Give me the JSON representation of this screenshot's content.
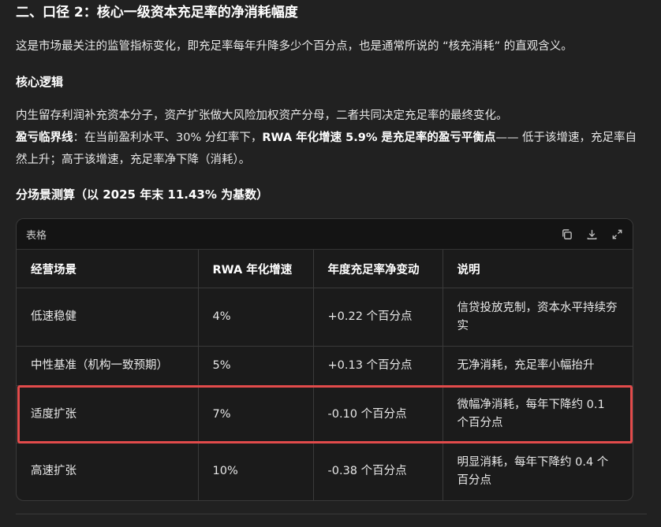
{
  "heading": "二、口径 2：核心一级资本充足率的净消耗幅度",
  "intro": "这是市场最关注的监管指标变化，即充足率每年升降多少个百分点，也是通常所说的 “核充消耗” 的直观含义。",
  "logic_title": "核心逻辑",
  "logic_line1": "内生留存利润补充资本分子，资产扩张做大风险加权资产分母，二者共同决定充足率的最终变化。",
  "breakeven_label": "盈亏临界线",
  "breakeven_text_a": "：在当前盈利水平、30% 分红率下，",
  "breakeven_bold": "RWA 年化增速 5.9% 是充足率的盈亏平衡点",
  "breakeven_text_b": "—— 低于该增速，充足率自然上升；高于该增速，充足率净下降（消耗）。",
  "scenario_title": "分场景测算（以 2025 年末 11.43% 为基数）",
  "table": {
    "title": "表格",
    "icons": [
      "copy-icon",
      "download-icon",
      "expand-icon"
    ],
    "headers": [
      "经营场景",
      "RWA 年化增速",
      "年度充足率净变动",
      "说明"
    ],
    "rows": [
      [
        "低速稳健",
        "4%",
        "+0.22 个百分点",
        "信贷投放克制，资本水平持续夯实"
      ],
      [
        "中性基准（机构一致预期）",
        "5%",
        "+0.13 个百分点",
        "无净消耗，充足率小幅抬升"
      ],
      [
        "适度扩张",
        "7%",
        "-0.10 个百分点",
        "微幅净消耗，每年下降约 0.1 个百分点"
      ],
      [
        "高速扩张",
        "10%",
        "-0.38 个百分点",
        "明显消耗，每年下降约 0.4 个百分点"
      ]
    ],
    "highlighted_row_index": 2,
    "highlight_color": "#e24b4b"
  }
}
